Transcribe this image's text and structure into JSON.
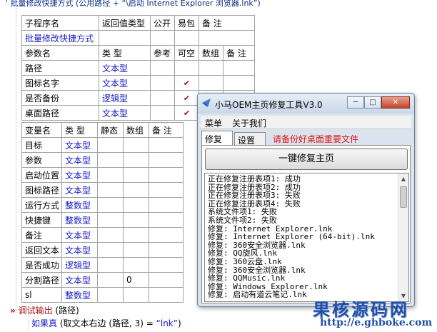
{
  "top_code": {
    "prefix": "' 批量修改快捷方式 (公用路径 + ",
    "string": "“\\启动 Internet Explorer 浏览器.lnk”)"
  },
  "sub_table": {
    "headers": [
      "子程序名",
      "返回值类型",
      "公开",
      "易包",
      "备 注"
    ],
    "name": "批量修改快捷方式"
  },
  "param_table": {
    "headers": [
      "参数名",
      "类 型",
      "参考",
      "可空",
      "数组",
      "备 注"
    ],
    "rows": [
      {
        "name": "路径",
        "type": "文本型",
        "ref": "",
        "nullable": "",
        "array": "",
        "note": ""
      },
      {
        "name": "图标名字",
        "type": "文本型",
        "ref": "",
        "nullable": "✔",
        "array": "",
        "note": ""
      },
      {
        "name": "是否备份",
        "type": "逻辑型",
        "ref": "",
        "nullable": "✔",
        "array": "",
        "note": ""
      },
      {
        "name": "桌面路径",
        "type": "文本型",
        "ref": "",
        "nullable": "✔",
        "array": "",
        "note": ""
      }
    ]
  },
  "var_table": {
    "headers": [
      "变量名",
      "类 型",
      "静态",
      "数组",
      "备 注"
    ],
    "rows": [
      {
        "name": "目标",
        "type": "文本型",
        "static": "",
        "array": "",
        "note": ""
      },
      {
        "name": "参数",
        "type": "文本型",
        "static": "",
        "array": "",
        "note": ""
      },
      {
        "name": "启动位置",
        "type": "文本型",
        "static": "",
        "array": "",
        "note": ""
      },
      {
        "name": "图标路径",
        "type": "文本型",
        "static": "",
        "array": "",
        "note": ""
      },
      {
        "name": "运行方式",
        "type": "整数型",
        "static": "",
        "array": "",
        "note": ""
      },
      {
        "name": "快捷键",
        "type": "整数型",
        "static": "",
        "array": "",
        "note": ""
      },
      {
        "name": "备注",
        "type": "文本型",
        "static": "",
        "array": "",
        "note": ""
      },
      {
        "name": "返回文本",
        "type": "文本型",
        "static": "",
        "array": "",
        "note": ""
      },
      {
        "name": "是否成功",
        "type": "逻辑型",
        "static": "",
        "array": "",
        "note": ""
      },
      {
        "name": "分割路径",
        "type": "文本型",
        "static": "",
        "array": "0",
        "note": ""
      },
      {
        "name": "sl",
        "type": "整数型",
        "static": "",
        "array": "",
        "note": ""
      }
    ]
  },
  "code": {
    "line1_fn": "调试输出",
    "line1_arg": " (路径)",
    "line2_kw": "如果真",
    "line2_rest": " (取文本右边 (路径, 3) = ",
    "line2_str": "“lnk”",
    "line2_end": ")"
  },
  "window": {
    "title": "小马OEM主页修复工具V3.0",
    "menu": [
      "菜单",
      "关于我们"
    ],
    "tabs": [
      "修复",
      "设置"
    ],
    "tab_note": "请备份好桌面重要文件",
    "main_button": "一键修复主页",
    "log": [
      "正在修复注册表项1: 成功",
      "正在修复注册表项2: 成功",
      "正在修复注册表项3: 失败",
      "正在修复注册表项4: 失败",
      "系统文件项1: 失败",
      "系统文件项2: 失败",
      "修复: Internet Explorer.lnk",
      "修复: Internet Explorer (64-bit).lnk",
      "修复: 360安全浏览器.lnk",
      "修复: QQ旋风.lnk",
      "修复: 360云盘.lnk",
      "修复: 360安全浏览器.lnk",
      "修复: QQMusic.lnk",
      "修复: Windows Explorer.lnk",
      "修复: 启动有道云笔记.lnk"
    ],
    "controls": {
      "min": "─",
      "max": "□",
      "close": "✕"
    }
  },
  "watermark": {
    "cn": "果核源码网",
    "url": "http://e.ghboke.com"
  },
  "colors": {
    "type_blue": "#1818c8",
    "check_red": "#a01010",
    "warning_red": "#e01010",
    "watermark_blue": "#1f4fa8"
  }
}
